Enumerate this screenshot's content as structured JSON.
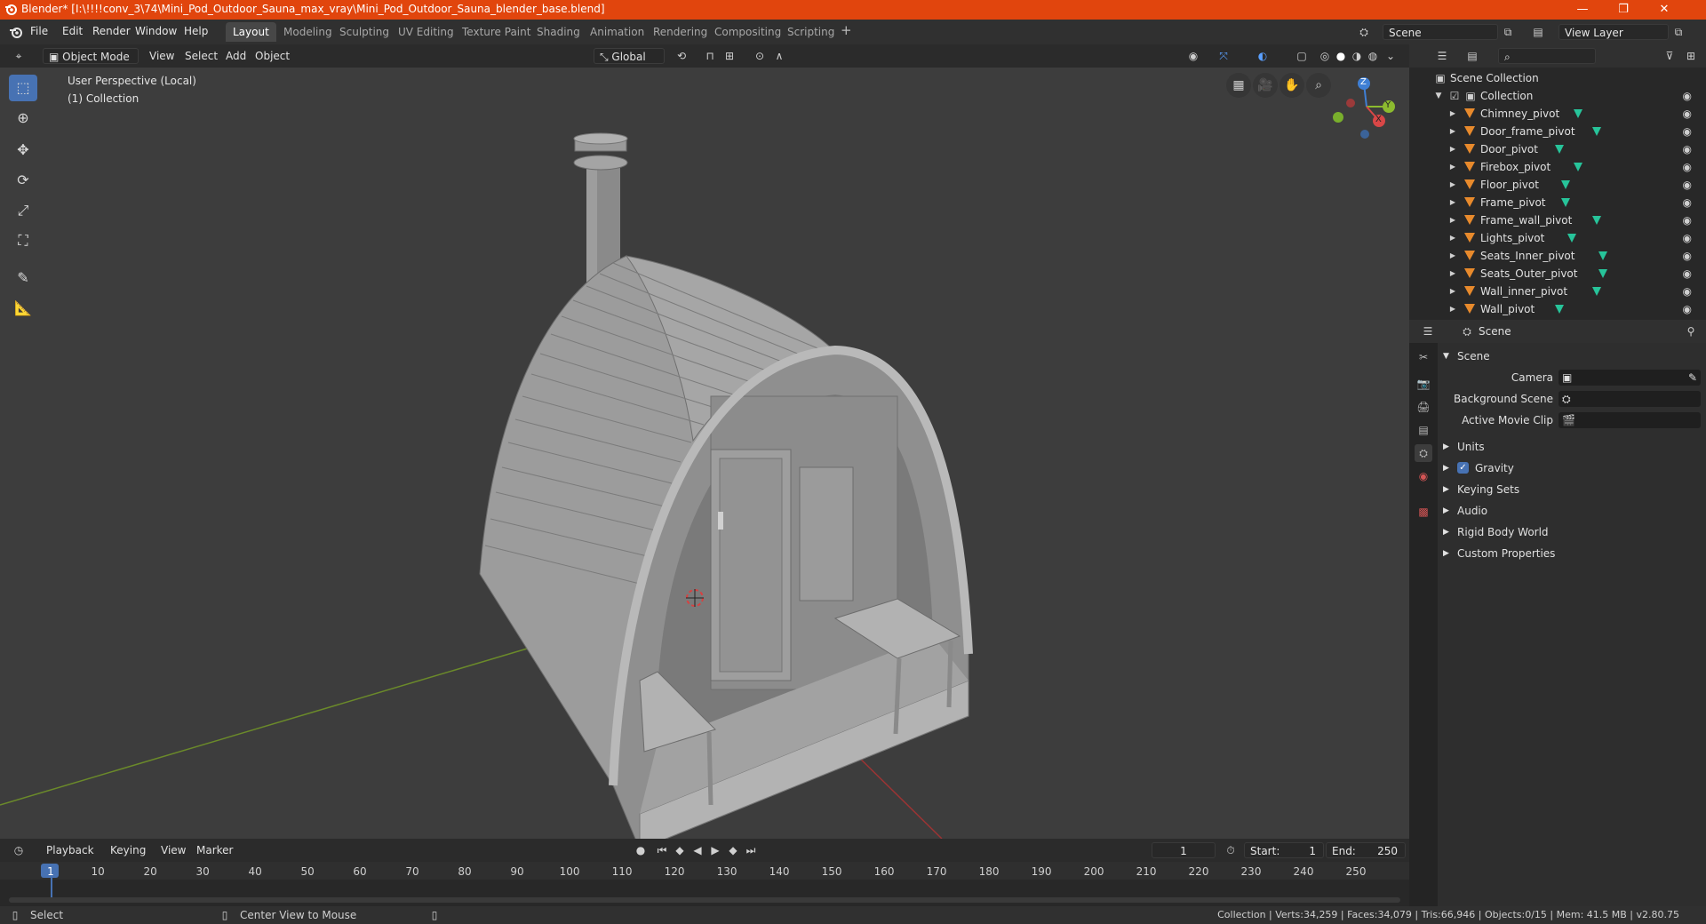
{
  "window": {
    "title": "Blender* [I:\\!!!!conv_3\\74\\Mini_Pod_Outdoor_Sauna_max_vray\\Mini_Pod_Outdoor_Sauna_blender_base.blend]",
    "minimize": "—",
    "maximize": "❐",
    "close": "✕"
  },
  "menu": {
    "items": [
      "File",
      "Edit",
      "Render",
      "Window",
      "Help"
    ]
  },
  "workspaces": {
    "tabs": [
      "Layout",
      "Modeling",
      "Sculpting",
      "UV Editing",
      "Texture Paint",
      "Shading",
      "Animation",
      "Rendering",
      "Compositing",
      "Scripting"
    ],
    "active": "Layout",
    "add": "+"
  },
  "scene_selector": {
    "value": "Scene"
  },
  "view_layer_selector": {
    "value": "View Layer"
  },
  "viewport_header": {
    "mode": "Object Mode",
    "menus": [
      "View",
      "Select",
      "Add",
      "Object"
    ],
    "transform_orientation": "Global"
  },
  "viewport": {
    "perspective_label": "User Perspective (Local)",
    "collection_label": "(1) Collection",
    "gizmo": {
      "z": "Z",
      "y": "Y",
      "x": "X"
    }
  },
  "outliner": {
    "search_placeholder": "",
    "root": "Scene Collection",
    "collection": "Collection",
    "items": [
      "Chimney_pivot",
      "Door_frame_pivot",
      "Door_pivot",
      "Firebox_pivot",
      "Floor_pivot",
      "Frame_pivot",
      "Frame_wall_pivot",
      "Lights_pivot",
      "Seats_Inner_pivot",
      "Seats_Outer_pivot",
      "Wall_inner_pivot",
      "Wall_pivot"
    ]
  },
  "properties": {
    "header_title": "Scene",
    "section_scene": "Scene",
    "camera_label": "Camera",
    "background_scene_label": "Background Scene",
    "active_movie_clip_label": "Active Movie Clip",
    "panels": [
      "Units",
      "Gravity",
      "Keying Sets",
      "Audio",
      "Rigid Body World",
      "Custom Properties"
    ],
    "gravity_checked": true
  },
  "timeline": {
    "menus": [
      "Playback",
      "Keying",
      "View",
      "Marker"
    ],
    "current_frame": "1",
    "start_label": "Start:",
    "start_value": "1",
    "end_label": "End:",
    "end_value": "250",
    "ruler": [
      "1",
      "10",
      "20",
      "30",
      "40",
      "50",
      "60",
      "70",
      "80",
      "90",
      "100",
      "110",
      "120",
      "130",
      "140",
      "150",
      "160",
      "170",
      "180",
      "190",
      "200",
      "210",
      "220",
      "230",
      "240",
      "250"
    ]
  },
  "statusbar": {
    "select": "Select",
    "center_view": "Center View to Mouse",
    "stats": "Collection | Verts:34,259 | Faces:34,079 | Tris:66,946 | Objects:0/15 | Mem: 41.5 MB | v2.80.75"
  },
  "colors": {
    "titlebar": "#e1450d",
    "accent": "#4772b3",
    "object_icon": "#e88a2c",
    "mesh_icon": "#27c49a"
  }
}
